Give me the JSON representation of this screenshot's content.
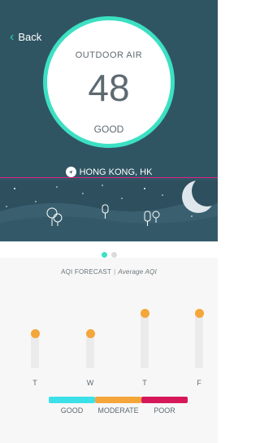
{
  "nav": {
    "back_label": "Back"
  },
  "aqi": {
    "title": "OUTDOOR AIR",
    "value": "48",
    "status": "GOOD"
  },
  "location": {
    "name": "HONG KONG, HK"
  },
  "pager": {
    "pages": 2,
    "active": 0
  },
  "forecast": {
    "title": "AQI FORECAST",
    "subtitle": "Average AQI",
    "days": [
      {
        "label": "T",
        "level": 0.6
      },
      {
        "label": "W",
        "level": 0.6
      },
      {
        "label": "T",
        "level": 0.95
      },
      {
        "label": "F",
        "level": 0.95
      }
    ]
  },
  "legend": [
    {
      "label": "GOOD",
      "color": "#3ce0e8"
    },
    {
      "label": "MODERATE",
      "color": "#f4a63a"
    },
    {
      "label": "POOR",
      "color": "#d6175a"
    }
  ],
  "colors": {
    "header_bg": "#2f5563",
    "accent": "#3ce0c3",
    "marker": "#f4a63a"
  },
  "icons": {
    "back": "chevron-left-icon",
    "location": "navigation-arrow-icon",
    "moon": "crescent-moon-icon"
  }
}
